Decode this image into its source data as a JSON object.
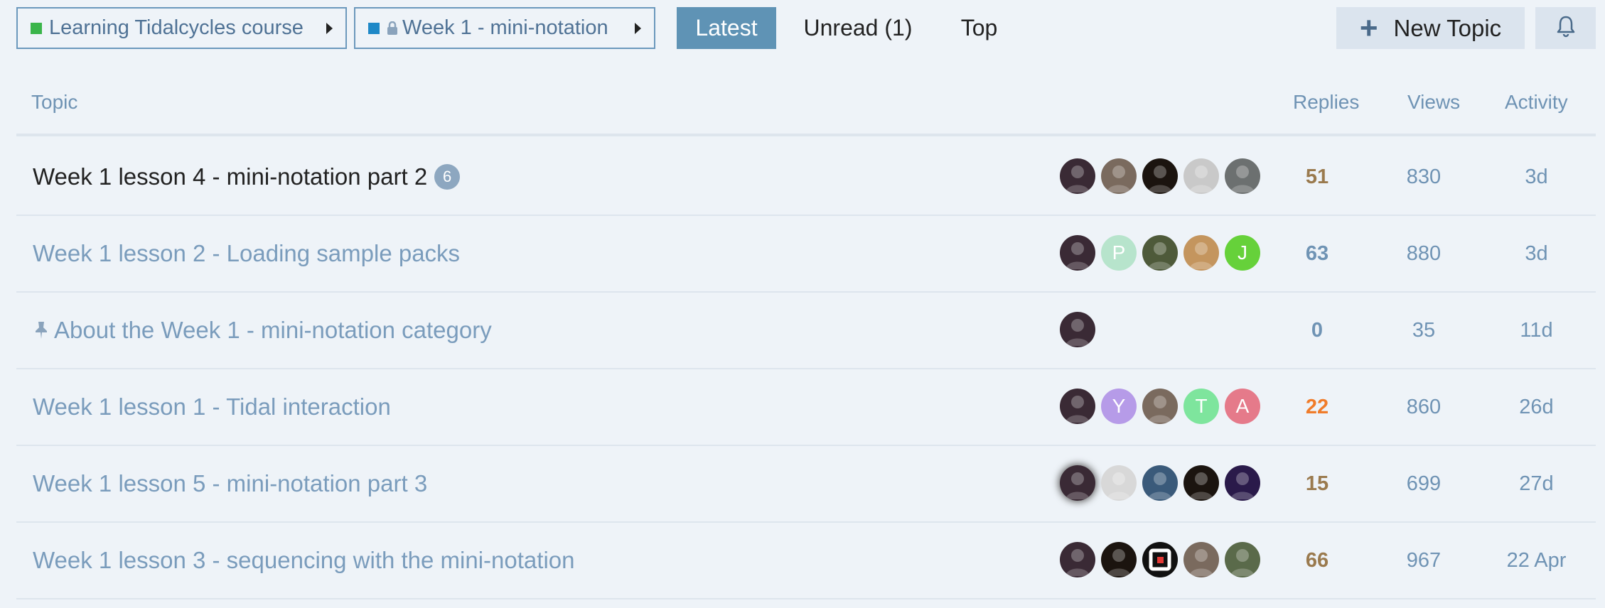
{
  "breadcrumbs": [
    {
      "label": "Learning Tidalcycles course",
      "color": "#3ab54a"
    },
    {
      "label": "Week 1 - mini-notation",
      "color": "#1e88c7",
      "locked": true
    }
  ],
  "nav": {
    "latest": "Latest",
    "unread": "Unread (1)",
    "top": "Top"
  },
  "actions": {
    "new_topic": "New Topic",
    "bell_icon": "bell-icon"
  },
  "table": {
    "headers": {
      "topic": "Topic",
      "replies": "Replies",
      "views": "Views",
      "activity": "Activity"
    },
    "rows": [
      {
        "title": "Week 1 lesson 4 - mini-notation part 2",
        "unread": true,
        "new_posts": "6",
        "replies": "51",
        "replies_color": "#9a7a4e",
        "views": "830",
        "activity": "3d",
        "posters": [
          {
            "kind": "photo",
            "bg": "#3a2a35"
          },
          {
            "kind": "photo",
            "bg": "#7a6a5e"
          },
          {
            "kind": "photo",
            "bg": "#1b140f"
          },
          {
            "kind": "photo",
            "bg": "#c9c9c9"
          },
          {
            "kind": "photo",
            "bg": "#6c7070"
          }
        ]
      },
      {
        "title": "Week 1 lesson 2 - Loading sample packs",
        "unread": false,
        "replies": "63",
        "replies_color": "#6f93b4",
        "views": "880",
        "activity": "3d",
        "posters": [
          {
            "kind": "photo",
            "bg": "#3a2a35"
          },
          {
            "kind": "letter",
            "letter": "P",
            "bg": "#b7e4cc"
          },
          {
            "kind": "photo",
            "bg": "#4e5a3a"
          },
          {
            "kind": "photo",
            "bg": "#c4955e"
          },
          {
            "kind": "letter",
            "letter": "J",
            "bg": "#66d13a"
          }
        ]
      },
      {
        "title": "About the Week 1 - mini-notation category",
        "unread": false,
        "pinned": true,
        "replies": "0",
        "replies_color": "#6f93b4",
        "views": "35",
        "activity": "11d",
        "posters": [
          {
            "kind": "photo",
            "bg": "#3a2a35"
          }
        ]
      },
      {
        "title": "Week 1 lesson 1 - Tidal interaction",
        "unread": false,
        "replies": "22",
        "replies_color": "#f07c2a",
        "views": "860",
        "activity": "26d",
        "posters": [
          {
            "kind": "photo",
            "bg": "#3a2a35"
          },
          {
            "kind": "letter",
            "letter": "Y",
            "bg": "#b69be8"
          },
          {
            "kind": "photo",
            "bg": "#7a6a5e"
          },
          {
            "kind": "letter",
            "letter": "T",
            "bg": "#7ee59d"
          },
          {
            "kind": "letter",
            "letter": "A",
            "bg": "#e57a8a"
          }
        ]
      },
      {
        "title": "Week 1 lesson 5 - mini-notation part 3",
        "unread": false,
        "replies": "15",
        "replies_color": "#9a7a4e",
        "views": "699",
        "activity": "27d",
        "posters": [
          {
            "kind": "photo",
            "bg": "#3a2a35",
            "op": true
          },
          {
            "kind": "photo",
            "bg": "#d8d8d8"
          },
          {
            "kind": "photo",
            "bg": "#3a5a7a"
          },
          {
            "kind": "photo",
            "bg": "#1b140f"
          },
          {
            "kind": "photo",
            "bg": "#2a1a4a"
          }
        ]
      },
      {
        "title": "Week 1 lesson 3 - sequencing with the mini-notation",
        "unread": false,
        "replies": "66",
        "replies_color": "#9a7a4e",
        "views": "967",
        "activity": "22 Apr",
        "posters": [
          {
            "kind": "photo",
            "bg": "#3a2a35"
          },
          {
            "kind": "photo",
            "bg": "#1b140f"
          },
          {
            "kind": "logo",
            "bg": "#111111"
          },
          {
            "kind": "photo",
            "bg": "#7a6a5e"
          },
          {
            "kind": "photo",
            "bg": "#5a6a4a"
          }
        ]
      }
    ]
  }
}
